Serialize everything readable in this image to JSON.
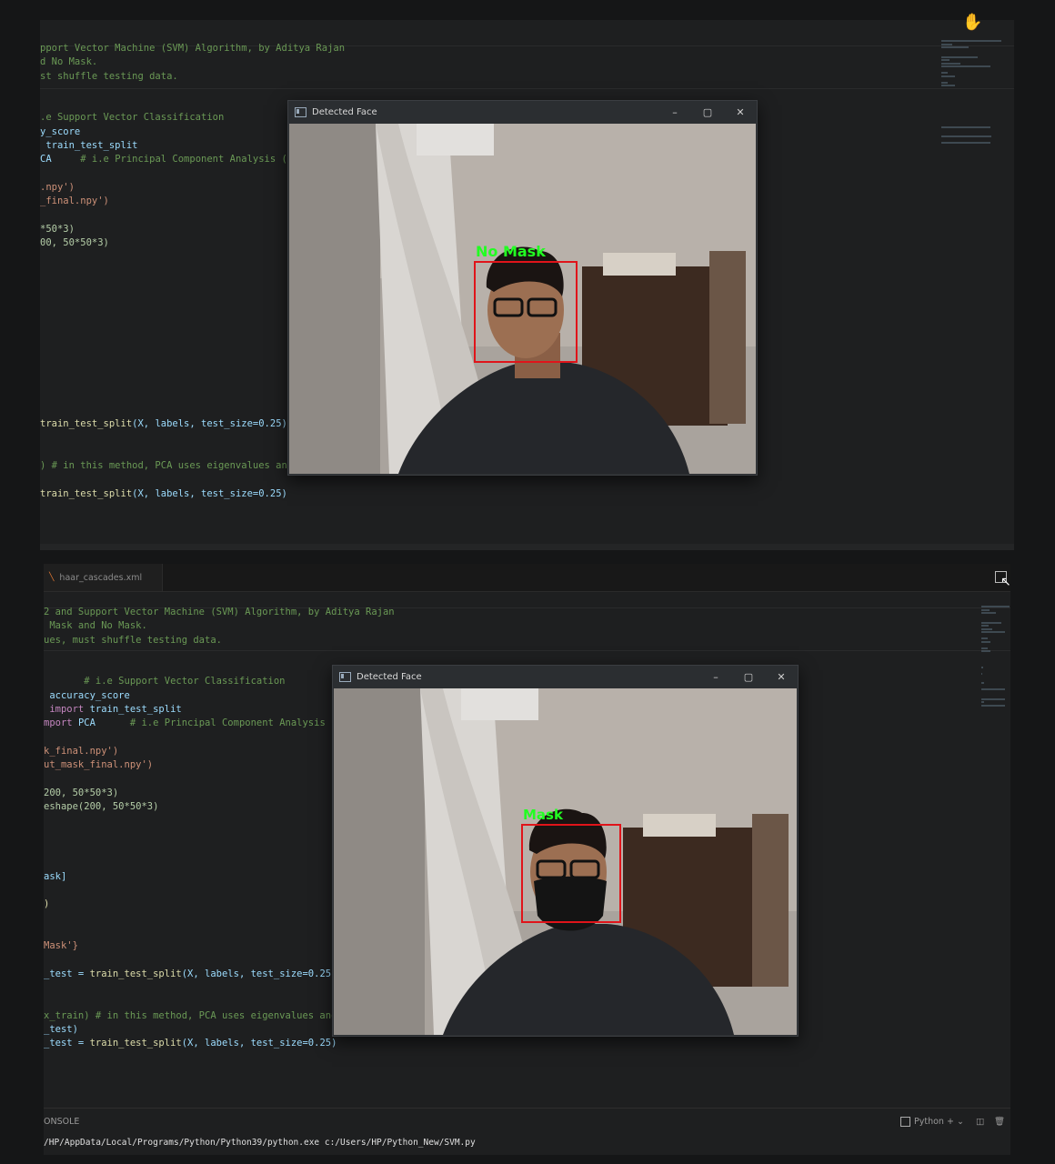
{
  "top_editor": {
    "code_lines": [
      [
        {
          "t": "pport Vector Machine (SVM) Algorithm, by Aditya Rajan",
          "c": "c-com"
        }
      ],
      [
        {
          "t": "d No Mask.",
          "c": "c-com"
        }
      ],
      [
        {
          "t": "st shuffle testing data.",
          "c": "c-com"
        }
      ],
      [],
      [],
      [
        {
          "t": ".e Support Vector Classification",
          "c": "c-com"
        }
      ],
      [
        {
          "t": "y_score",
          "c": "c-var"
        }
      ],
      [
        {
          "t": " train_test_split",
          "c": "c-var"
        }
      ],
      [
        {
          "t": "CA",
          "c": "c-var"
        },
        {
          "t": "     # i.e Principal Component Analysis (",
          "c": "c-com"
        }
      ],
      [],
      [
        {
          "t": ".npy')",
          "c": "c-str"
        }
      ],
      [
        {
          "t": "_final.npy')",
          "c": "c-str"
        }
      ],
      [],
      [
        {
          "t": "*50*3)",
          "c": "c-num"
        }
      ],
      [
        {
          "t": "00, 50*50*3)",
          "c": "c-num"
        }
      ],
      [],
      [],
      [],
      [],
      [],
      [],
      [],
      [],
      [],
      [],
      [],
      [],
      [
        {
          "t": "train_test_split",
          "c": "c-fn"
        },
        {
          "t": "(X, labels, test_size=0.25)",
          "c": "c-var"
        }
      ],
      [],
      [],
      [
        {
          "t": ") # in this method, PCA uses eigenvalues and",
          "c": "c-com"
        }
      ],
      [],
      [
        {
          "t": "train_test_split",
          "c": "c-fn"
        },
        {
          "t": "(X, labels, test_size=0.25)",
          "c": "c-var"
        }
      ]
    ]
  },
  "bottom_editor": {
    "tab_label": "haar_cascades.xml",
    "code_lines": [
      [
        {
          "t": "2 and Support Vector Machine (SVM) Algorithm, by Aditya Rajan",
          "c": "c-com"
        }
      ],
      [
        {
          "t": " Mask and No Mask.",
          "c": "c-com"
        }
      ],
      [
        {
          "t": "ues, must shuffle testing data.",
          "c": "c-com"
        }
      ],
      [],
      [],
      [
        {
          "t": "       # i.e Support Vector Classification",
          "c": "c-com"
        }
      ],
      [
        {
          "t": " accuracy_score",
          "c": "c-var"
        }
      ],
      [
        {
          "t": " import ",
          "c": "c-kw"
        },
        {
          "t": "train_test_split",
          "c": "c-var"
        }
      ],
      [
        {
          "t": "mport ",
          "c": "c-kw"
        },
        {
          "t": "PCA",
          "c": "c-var"
        },
        {
          "t": "      # i.e Principal Component Analysis (",
          "c": "c-com"
        }
      ],
      [],
      [
        {
          "t": "k_final.npy')",
          "c": "c-str"
        }
      ],
      [
        {
          "t": "ut_mask_final.npy')",
          "c": "c-str"
        }
      ],
      [],
      [
        {
          "t": "200, 50*50*3)",
          "c": "c-num"
        }
      ],
      [
        {
          "t": "eshape(200, 50*50*3)",
          "c": "c-num"
        }
      ],
      [],
      [],
      [],
      [],
      [
        {
          "t": "ask]",
          "c": "c-var"
        }
      ],
      [],
      [
        {
          "t": ")",
          "c": "c-fn"
        }
      ],
      [],
      [],
      [
        {
          "t": "Mask'}",
          "c": "c-str"
        }
      ],
      [],
      [
        {
          "t": "_test = ",
          "c": "c-var"
        },
        {
          "t": "train_test_split",
          "c": "c-fn"
        },
        {
          "t": "(X, labels, test_size=0.25)",
          "c": "c-var"
        }
      ],
      [],
      [],
      [
        {
          "t": "x_train) # in this method, PCA uses eigenvalues and",
          "c": "c-com"
        }
      ],
      [
        {
          "t": "_test)",
          "c": "c-var"
        }
      ],
      [
        {
          "t": "_test = ",
          "c": "c-var"
        },
        {
          "t": "train_test_split",
          "c": "c-fn"
        },
        {
          "t": "(X, labels, test_size=0.25)",
          "c": "c-var"
        }
      ]
    ],
    "panel_label": "ONSOLE",
    "terminal_line": "/HP/AppData/Local/Programs/Python/Python39/python.exe c:/Users/HP/Python_New/SVM.py",
    "shell_label": "Python"
  },
  "window_top": {
    "title": "Detected Face",
    "detection_label": "No Mask"
  },
  "window_bottom": {
    "title": "Detected Face",
    "detection_label": "Mask"
  },
  "colors": {
    "detection_box": "#e0141a",
    "detection_text": "#22ff22"
  }
}
